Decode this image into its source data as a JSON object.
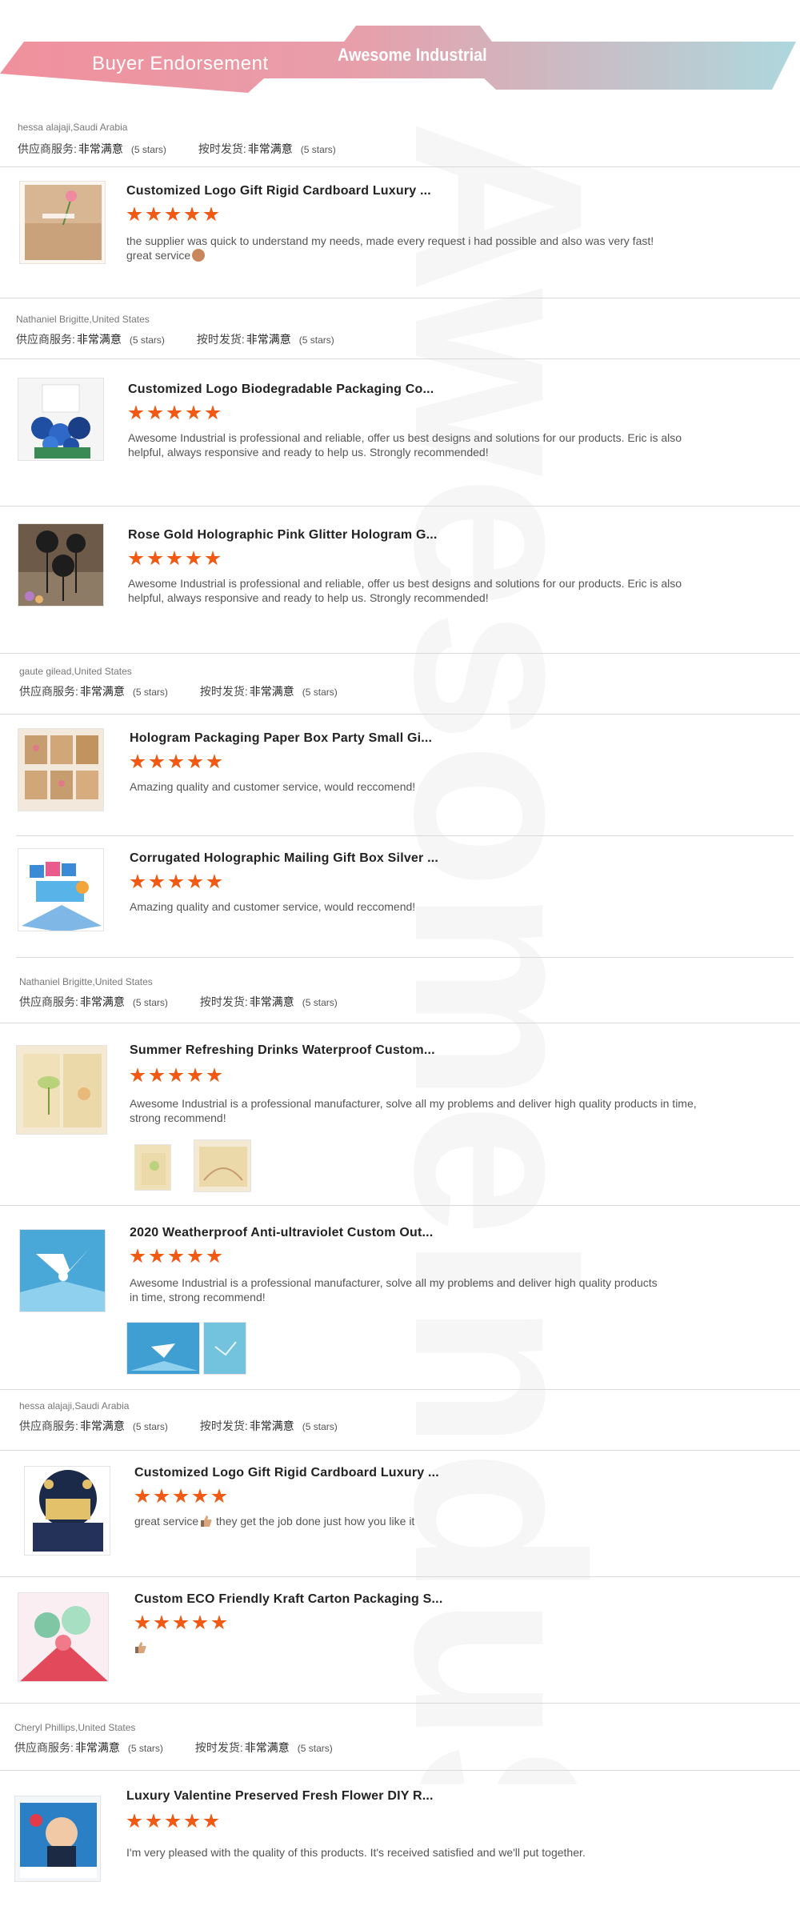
{
  "banner": {
    "title": "Buyer Endorsement",
    "brand": "Awesome Industrial"
  },
  "colors": {
    "banner_left": "#f08a98",
    "banner_right": "#a9d6dc",
    "star": "#f05a14",
    "divider": "#d9d9d9"
  },
  "watermark": "AwesomeInduS",
  "reviews": [
    {
      "reviewer": "hessa alajaji,Saudi Arabia",
      "service_label": "供应商服务:",
      "service_value": "非常满意",
      "service_stars": "(5 stars)",
      "shipping_label": "按时发货:",
      "shipping_value": "非常满意",
      "shipping_stars": "(5 stars)",
      "items": [
        {
          "title": "Customized Logo Gift Rigid Cardboard Luxury ...",
          "rating": 5,
          "comment": "the supplier was quick to understand my needs, made every request i had possible and also was very fast! great service",
          "image": "kraft-card-icon"
        }
      ]
    },
    {
      "reviewer": "Nathaniel Brigitte,United States",
      "service_label": "供应商服务:",
      "service_value": "非常满意",
      "service_stars": "(5 stars)",
      "shipping_label": "按时发货:",
      "shipping_value": "非常满意",
      "shipping_stars": "(5 stars)",
      "items": [
        {
          "title": "Customized Logo Biodegradable Packaging Co...",
          "rating": 5,
          "comment": "Awesome Industrial is professional and reliable, offer us best designs and solutions for our products. Eric is also helpful, always responsive and ready to help us. Strongly recommended!",
          "image": "flower-basket-icon"
        },
        {
          "title": "Rose Gold Holographic Pink Glitter Hologram G...",
          "rating": 5,
          "comment": "Awesome Industrial is professional and reliable, offer us best designs and solutions for our products. Eric is also helpful, always responsive and ready to help us. Strongly recommended!",
          "image": "cake-topper-icon"
        }
      ]
    },
    {
      "reviewer": "gaute gilead,United States",
      "service_label": "供应商服务:",
      "service_value": "非常满意",
      "service_stars": "(5 stars)",
      "shipping_label": "按时发货:",
      "shipping_value": "非常满意",
      "shipping_stars": "(5 stars)",
      "items": [
        {
          "title": "Hologram Packaging Paper Box Party Small Gi...",
          "rating": 5,
          "comment": "Amazing quality and customer service, would reccomend!",
          "image": "kraft-cards-grid-icon"
        },
        {
          "title": "Corrugated Holographic Mailing Gift Box Silver ...",
          "rating": 5,
          "comment": "Amazing quality and customer service, would reccomend!",
          "image": "popup-card-icon"
        }
      ]
    },
    {
      "reviewer": "Nathaniel Brigitte,United States",
      "service_label": "供应商服务:",
      "service_value": "非常满意",
      "service_stars": "(5 stars)",
      "shipping_label": "按时发货:",
      "shipping_value": "非常满意",
      "shipping_stars": "(5 stars)",
      "items": [
        {
          "title": "Summer Refreshing Drinks Waterproof Custom...",
          "rating": 5,
          "comment": "Awesome Industrial is a professional manufacturer, solve all my problems and deliver high quality products in time, strong recommend!",
          "image": "lotus-card-icon"
        },
        {
          "title": "2020 Weatherproof Anti-ultraviolet Custom Out...",
          "rating": 5,
          "comment": "Awesome Industrial is a professional manufacturer, solve all my problems and deliver high quality products in time, strong recommend!",
          "image": "crane-card-icon"
        }
      ]
    },
    {
      "reviewer": "hessa alajaji,Saudi Arabia",
      "service_label": "供应商服务:",
      "service_value": "非常满意",
      "service_stars": "(5 stars)",
      "shipping_label": "按时发货:",
      "shipping_value": "非常满意",
      "shipping_stars": "(5 stars)",
      "items": [
        {
          "title": "Customized Logo Gift Rigid Cardboard Luxury ...",
          "rating": 5,
          "comment_pre": "great service",
          "comment": "they get the job done just how you like it",
          "image": "birthday-card-icon"
        },
        {
          "title": "Custom ECO Friendly Kraft Carton Packaging S...",
          "rating": 5,
          "comment": "",
          "image": "pink-popup-card-icon"
        }
      ]
    },
    {
      "reviewer": "Cheryl Phillips,United States",
      "service_label": "供应商服务:",
      "service_value": "非常满意",
      "service_stars": "(5 stars)",
      "shipping_label": "按时发货:",
      "shipping_value": "非常满意",
      "shipping_stars": "(5 stars)",
      "items": [
        {
          "title": "Luxury Valentine Preserved Fresh Flower DIY R...",
          "rating": 5,
          "comment": "I'm very pleased with the quality of this products. It's received satisfied and we'll put together.",
          "image": "comic-card-icon"
        }
      ]
    }
  ]
}
